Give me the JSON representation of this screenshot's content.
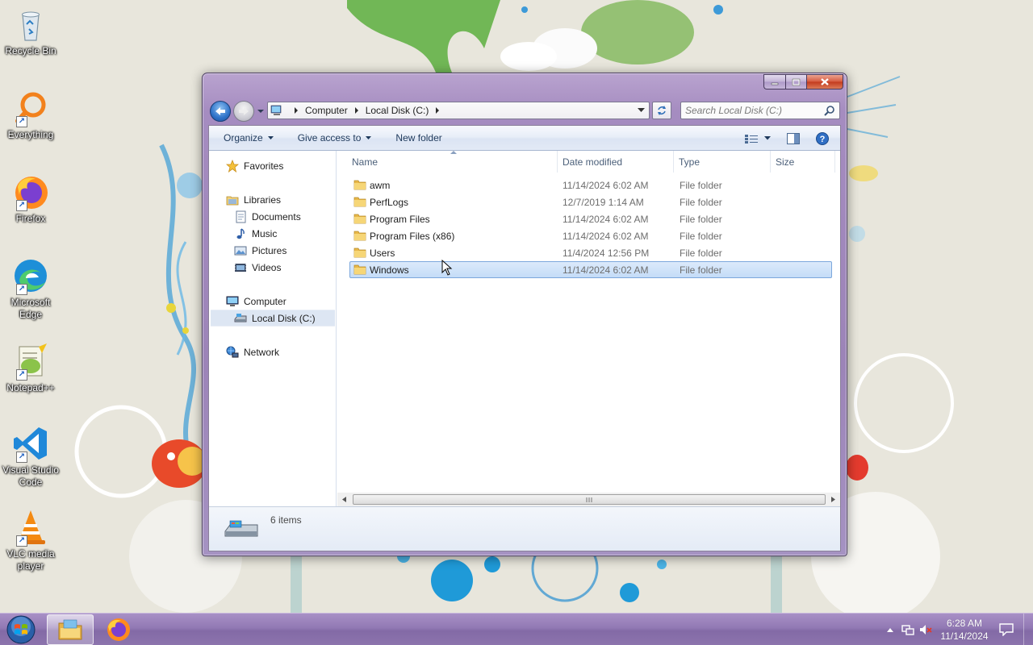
{
  "desktop": {
    "icons": [
      {
        "label": "Recycle Bin"
      },
      {
        "label": "Everything"
      },
      {
        "label": "Firefox"
      },
      {
        "label": "Microsoft Edge"
      },
      {
        "label": "Notepad++"
      },
      {
        "label": "Visual Studio Code"
      },
      {
        "label": "VLC media player"
      }
    ]
  },
  "window": {
    "address": {
      "crumbs": [
        "Computer",
        "Local Disk (C:)"
      ]
    },
    "search": {
      "placeholder": "Search Local Disk (C:)"
    },
    "toolbar": {
      "organize_label": "Organize",
      "give_access_label": "Give access to",
      "new_folder_label": "New folder"
    },
    "nav": {
      "favorites": "Favorites",
      "libraries": "Libraries",
      "documents": "Documents",
      "music": "Music",
      "pictures": "Pictures",
      "videos": "Videos",
      "computer": "Computer",
      "local_disk": "Local Disk (C:)",
      "network": "Network"
    },
    "columns": {
      "name": "Name",
      "date_modified": "Date modified",
      "type": "Type",
      "size": "Size"
    },
    "files": [
      {
        "name": "awm",
        "date": "11/14/2024 6:02 AM",
        "type": "File folder"
      },
      {
        "name": "PerfLogs",
        "date": "12/7/2019 1:14 AM",
        "type": "File folder"
      },
      {
        "name": "Program Files",
        "date": "11/14/2024 6:02 AM",
        "type": "File folder"
      },
      {
        "name": "Program Files (x86)",
        "date": "11/14/2024 6:02 AM",
        "type": "File folder"
      },
      {
        "name": "Users",
        "date": "11/4/2024 12:56 PM",
        "type": "File folder"
      },
      {
        "name": "Windows",
        "date": "11/14/2024 6:02 AM",
        "type": "File folder"
      }
    ],
    "status": {
      "item_count": "6 items"
    }
  },
  "taskbar": {
    "clock_time": "6:28 AM",
    "clock_date": "11/14/2024"
  },
  "colors": {
    "selection": "#cce0f8",
    "taskbar": "#8f76b0",
    "window_frame": "#a58cc0"
  }
}
